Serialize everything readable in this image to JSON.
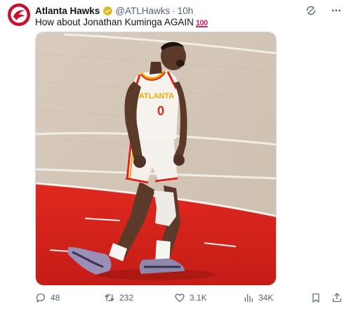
{
  "tweet": {
    "author_name": "Atlanta Hawks",
    "handle": "@ATLHawks",
    "separator": "·",
    "time": "10h",
    "text": "How about Jonathan Kuminga AGAIN",
    "emoji": "100",
    "media_alt": "Basketball player in white #0 Atlanta jersey celebrating on court",
    "jersey_text": "ATLANTA",
    "jersey_number": "0"
  },
  "stats": {
    "replies": "48",
    "reposts": "232",
    "likes": "3.1K",
    "views": "34K"
  },
  "icons": {
    "avatar": "hawks-logo-icon",
    "verified": "verified-badge-icon",
    "grok": "grok-icon",
    "more": "more-icon",
    "reply": "reply-icon",
    "repost": "repost-icon",
    "like": "heart-icon",
    "views": "views-icon",
    "bookmark": "bookmark-icon",
    "share": "share-icon"
  },
  "colors": {
    "brand_red": "#c8102e",
    "text_primary": "#0f1419",
    "text_secondary": "#536471",
    "verified_gold": "#e2b719"
  }
}
